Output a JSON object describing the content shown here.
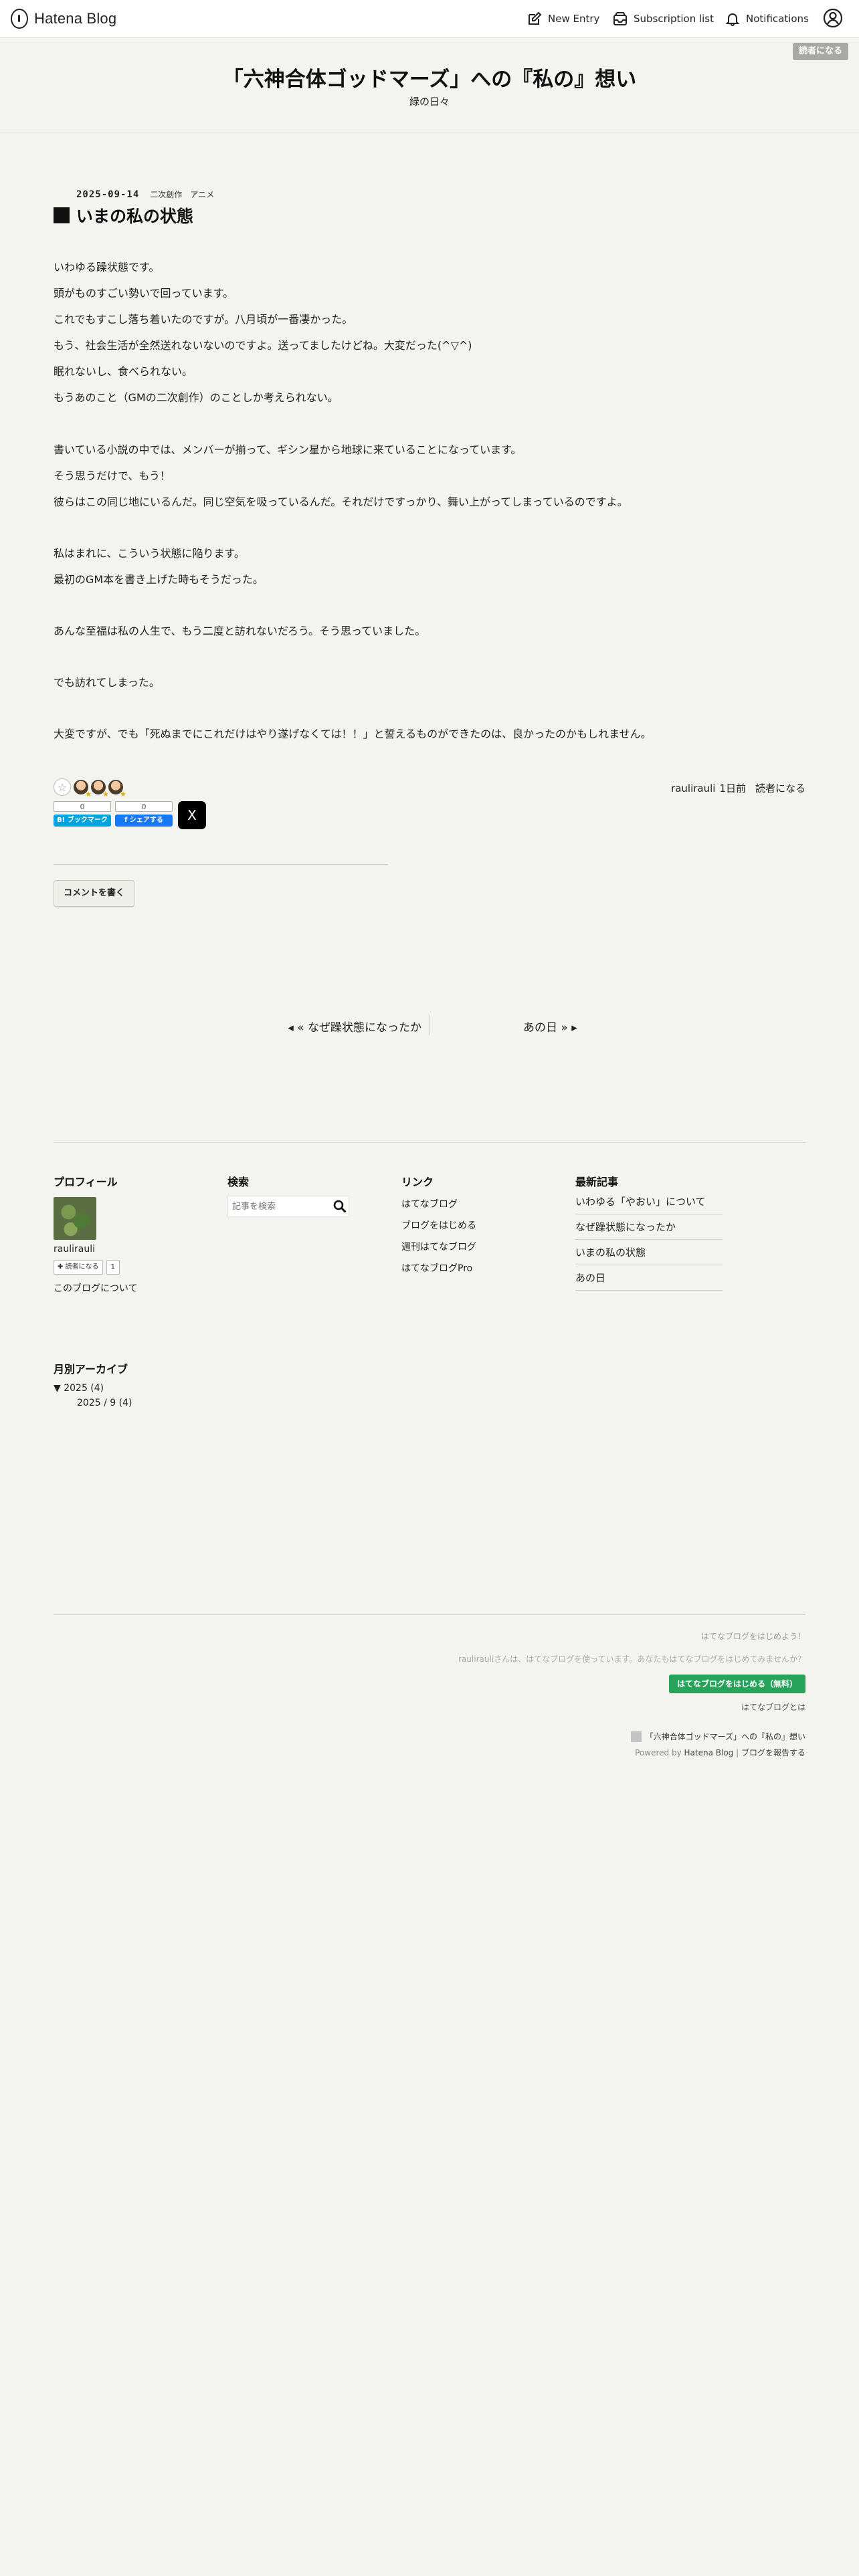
{
  "global_header": {
    "logo_text": "Hatena Blog",
    "new_entry": "New Entry",
    "subscription_list": "Subscription list",
    "notifications": "Notifications"
  },
  "reader_button": "読者になる",
  "blog": {
    "title": "「六神合体ゴッドマーズ」への『私の』想い",
    "description": "緑の日々"
  },
  "entry": {
    "date": "2025-09-14",
    "categories": [
      "二次創作",
      "アニメ"
    ],
    "title": "いまの私の状態",
    "lines": [
      "いわゆる躁状態です。",
      "頭がものすごい勢いで回っています。",
      "これでもすこし落ち着いたのですが。八月頃が一番凄かった。",
      "もう、社会生活が全然送れないないのですよ。送ってましたけどね。大変だった(^▽^)",
      "眠れないし、食べられない。",
      "もうあのこと（GMの二次創作）のことしか考えられない。",
      "書いている小説の中では、メンバーが揃って、ギシン星から地球に来ていることになっています。",
      "そう思うだけで、もう！",
      "彼らはこの同じ地にいるんだ。同じ空気を吸っているんだ。それだけですっかり、舞い上がってしまっているのですよ。",
      "私はまれに、こういう状態に陥ります。",
      "最初のGM本を書き上げた時もそうだった。",
      "あんな至福は私の人生で、もう二度と訪れないだろう。そう思っていました。",
      "でも訪れてしまった。",
      "大変ですが、でも「死ぬまでにこれだけはやり遂げなくては！！」と誓えるものができたのは、良かったのかもしれません。"
    ],
    "author": "raulirauli",
    "posted": "1日前",
    "subscribe": "読者になる",
    "hatebu_count": "0",
    "hatebu_label": "B! ブックマーク",
    "fb_count": "0",
    "fb_label": "f シェアする",
    "x_label": "X"
  },
  "comment_button": "コメントを書く",
  "pager": {
    "prev": "◂ « なぜ躁状態になったか",
    "next": "あの日 » ▸"
  },
  "sidebar": {
    "profile": {
      "heading": "プロフィール",
      "name": "raulirauli",
      "reader_btn": "✚ 読者になる",
      "reader_count": "1",
      "about": "このブログについて"
    },
    "search": {
      "heading": "検索",
      "placeholder": "記事を検索"
    },
    "links": {
      "heading": "リンク",
      "items": [
        "はてなブログ",
        "ブログをはじめる",
        "週刊はてなブログ",
        "はてなブログPro"
      ]
    },
    "recent": {
      "heading": "最新記事",
      "items": [
        "いわゆる「やおい」について",
        "なぜ躁状態になったか",
        "いまの私の状態",
        "あの日"
      ]
    },
    "archive": {
      "heading": "月別アーカイブ",
      "year": "▼ 2025 (4)",
      "month": "2025 / 9 (4)"
    }
  },
  "footer": {
    "promo1": "はてなブログをはじめよう！",
    "promo2": "raulirauliさんは、はてなブログを使っています。あなたもはてなブログをはじめてみませんか？",
    "start_button": "はてなブログをはじめる（無料）",
    "about": "はてなブログとは",
    "blog_name": "「六神合体ゴッドマーズ」への『私の』想い",
    "powered_prefix": "Powered by",
    "powered_link": "Hatena Blog",
    "report": "ブログを報告する"
  },
  "colors": {
    "background": "#f3f3ef",
    "start_button": "#27a35c",
    "hatebu": "#00a4de",
    "facebook": "#1877f2"
  }
}
